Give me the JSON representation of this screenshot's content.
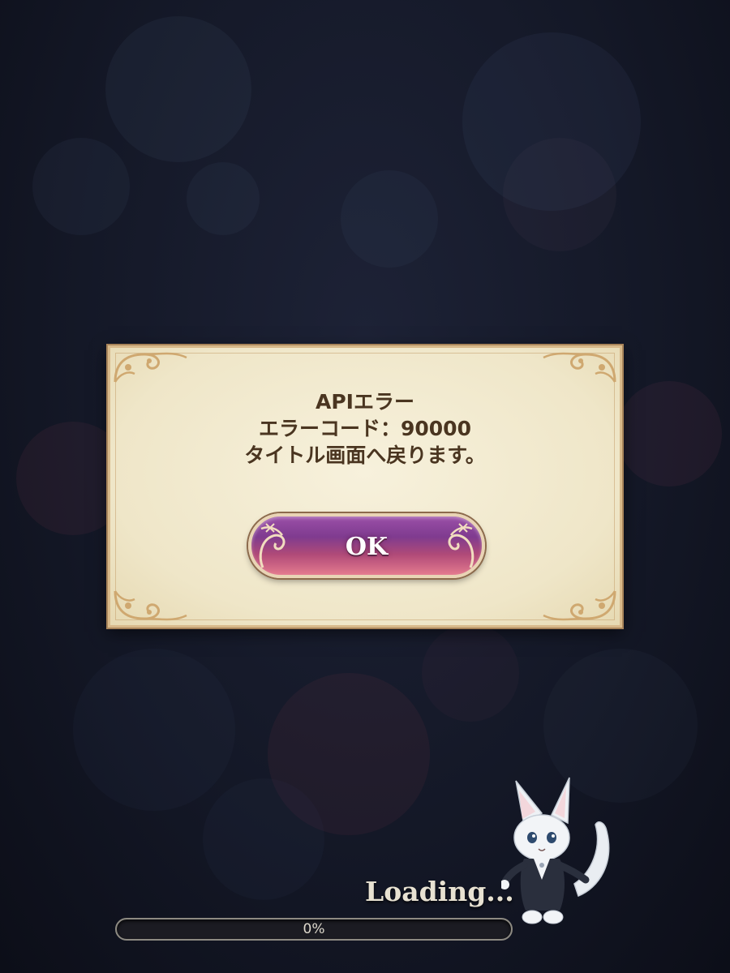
{
  "dialog": {
    "lines": [
      "APIエラー",
      "エラーコード：90000",
      "タイトル画面へ戻ります。"
    ],
    "ok_label": "OK"
  },
  "loading": {
    "text": "Loading...",
    "progress_label": "0%",
    "progress_value": 0
  },
  "colors": {
    "panel": "#efe6c8",
    "panel_border": "#d8b98a",
    "message_text": "#4a3520",
    "button_top": "#8a449b",
    "button_bottom": "#e47a8e"
  },
  "icons": {
    "corner_ornament": "gold-scroll-ornament-icon",
    "button_swirl": "swirl-ornament-icon",
    "mascot": "white-fox-mascot"
  }
}
